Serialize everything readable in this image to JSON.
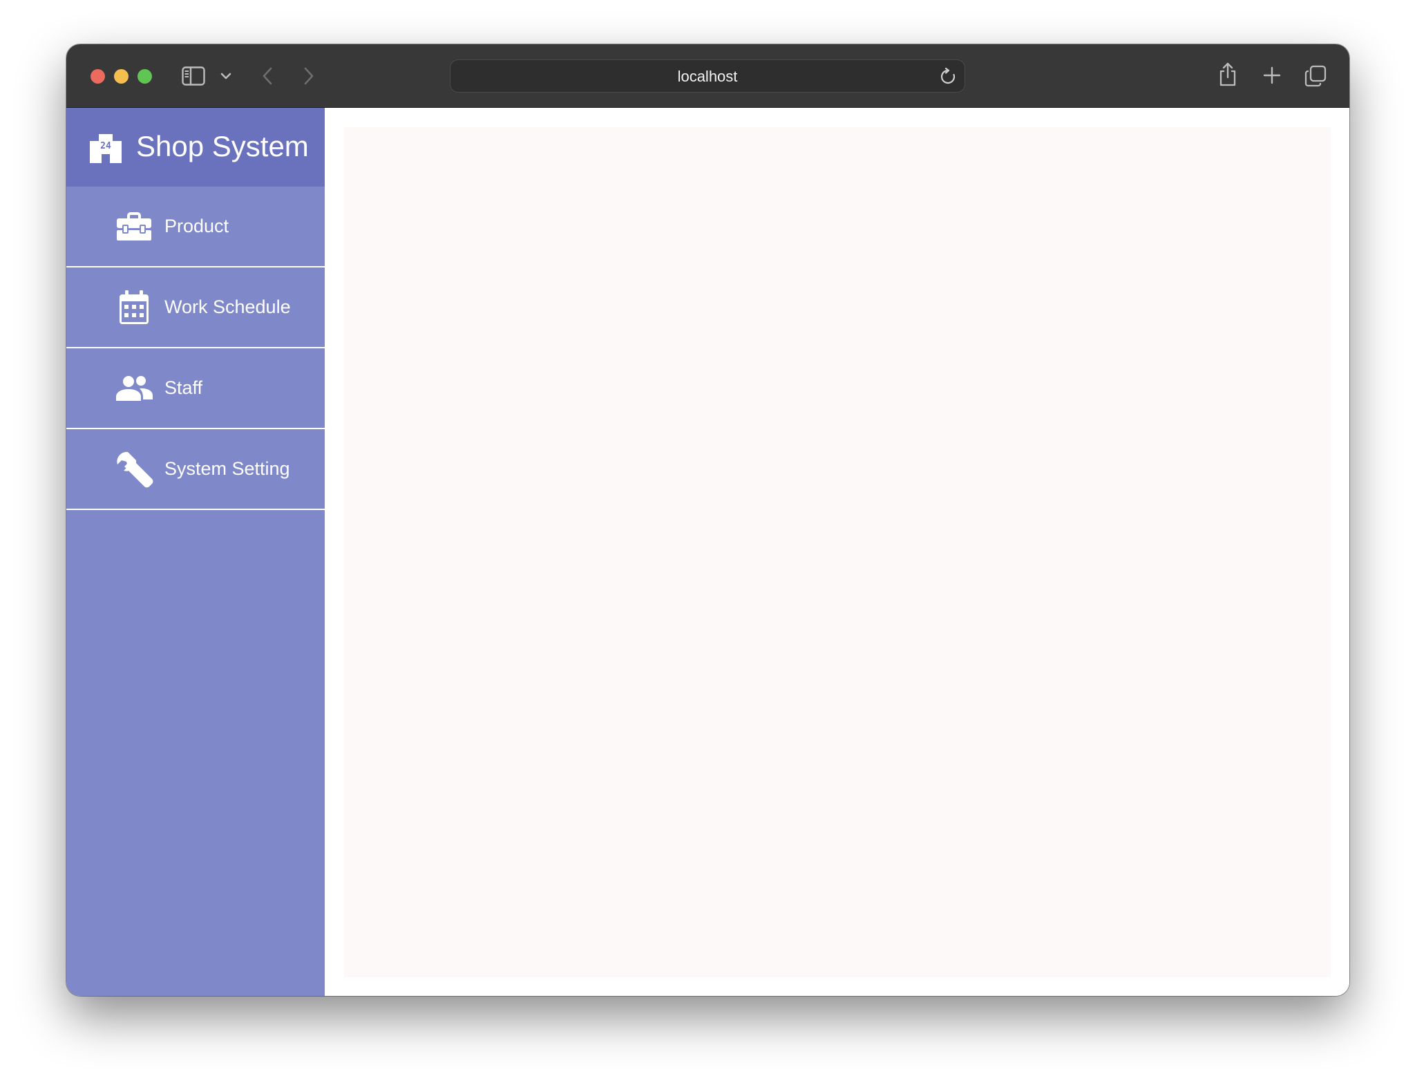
{
  "browser": {
    "url": "localhost"
  },
  "sidebar": {
    "brand_title": "Shop System",
    "brand_icon": "store-24-icon",
    "items": [
      {
        "label": "Product",
        "icon": "toolbox-icon"
      },
      {
        "label": "Work Schedule",
        "icon": "calendar-icon"
      },
      {
        "label": "Staff",
        "icon": "people-icon"
      },
      {
        "label": "System Setting",
        "icon": "wrench-icon"
      }
    ]
  },
  "colors": {
    "sidebar_bg": "#7f88c8",
    "brand_bg": "#6a72be",
    "content_bg": "#fdf9f8",
    "titlebar_bg": "#383838"
  }
}
